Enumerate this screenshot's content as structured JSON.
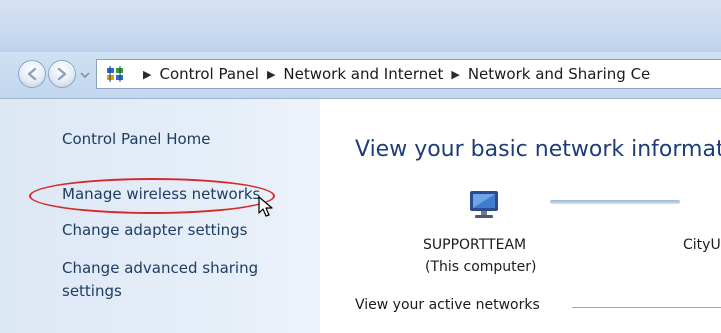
{
  "address_bar": {
    "crumbs": [
      "Control Panel",
      "Network and Internet",
      "Network and Sharing Ce"
    ]
  },
  "sidebar": {
    "items": [
      {
        "label": "Control Panel Home"
      },
      {
        "label": "Manage wireless networks",
        "highlighted": true
      },
      {
        "label": "Change adapter settings"
      },
      {
        "label": "Change advanced sharing"
      },
      {
        "label": "settings"
      }
    ]
  },
  "main": {
    "heading": "View your basic network informati",
    "computer_name": "SUPPORTTEAM",
    "computer_caption": "(This computer)",
    "network_name": "CityU",
    "active_networks_label": "View your active networks"
  },
  "colors": {
    "link": "#1e3d63",
    "heading": "#1e3d78",
    "annotation_ellipse": "#d42a2a"
  },
  "icons": [
    "back-arrow-icon",
    "forward-arrow-icon",
    "control-panel-icon",
    "breadcrumb-separator-icon",
    "computer-icon",
    "mouse-cursor-icon"
  ]
}
